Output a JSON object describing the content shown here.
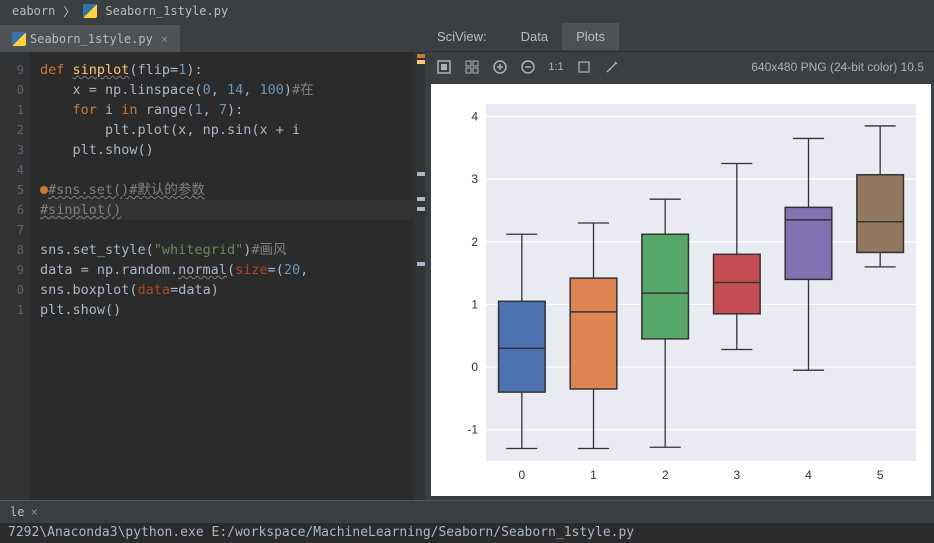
{
  "breadcrumb": {
    "folder": "eaborn",
    "file": "Seaborn_1style.py"
  },
  "editor": {
    "tab_name": "Seaborn_1style.py",
    "line_numbers": [
      "9",
      "0",
      "1",
      "2",
      "3",
      "4",
      "5",
      "6",
      "7",
      "8",
      "9",
      "0",
      "1"
    ],
    "code": {
      "l1_def": "def ",
      "l1_fn": "sinplot",
      "l1_rest": "(flip=",
      "l1_num": "1",
      "l1_end": "):",
      "l2_a": "    x = np.linspace(",
      "l2_n1": "0",
      "l2_c1": ", ",
      "l2_n2": "14",
      "l2_c2": ", ",
      "l2_n3": "100",
      "l2_end": ")",
      "l2_comment": "#在",
      "l3_a": "    ",
      "l3_for": "for ",
      "l3_b": "i ",
      "l3_in": "in ",
      "l3_c": "range(",
      "l3_n1": "1",
      "l3_c1": ", ",
      "l3_n2": "7",
      "l3_end": "):",
      "l4_a": "        plt.plot(x",
      "l4_c": ", ",
      "l4_b": "np.sin(x + i",
      "l5": "    plt.show()",
      "l7_comment": "#sns.set()#默认的参数",
      "l8_comment": "#sinplot()",
      "l10_a": "sns.set_style(",
      "l10_str": "\"whitegrid\"",
      "l10_b": ")",
      "l10_comment": "#画风",
      "l11_a": "data = np.random.",
      "l11_fn": "normal",
      "l11_b": "(",
      "l11_p": "size",
      "l11_c": "=(",
      "l11_n": "20",
      "l11_end": ",",
      "l12_a": "sns.boxplot(",
      "l12_p": "data",
      "l12_b": "=data)",
      "l13": "plt.show()"
    }
  },
  "sciview": {
    "title": "SciView:",
    "tab_data": "Data",
    "tab_plots": "Plots",
    "info": "640x480 PNG (24-bit color) 10.5",
    "toolbar": {
      "ratio": "1:1"
    }
  },
  "console": {
    "tab": "le",
    "text": "7292\\Anaconda3\\python.exe E:/workspace/MachineLearning/Seaborn/Seaborn_1style.py"
  },
  "chart_data": {
    "type": "box",
    "categories": [
      "0",
      "1",
      "2",
      "3",
      "4",
      "5"
    ],
    "ylim": [
      -1.5,
      4.2
    ],
    "yticks": [
      -1,
      0,
      1,
      2,
      3,
      4
    ],
    "series": [
      {
        "name": "0",
        "q1": -0.4,
        "median": 0.3,
        "q3": 1.05,
        "whisker_low": -1.3,
        "whisker_high": 2.12,
        "color": "#4c72b0"
      },
      {
        "name": "1",
        "q1": -0.35,
        "median": 0.88,
        "q3": 1.42,
        "whisker_low": -1.3,
        "whisker_high": 2.3,
        "color": "#dd8452"
      },
      {
        "name": "2",
        "q1": 0.45,
        "median": 1.18,
        "q3": 2.12,
        "whisker_low": -1.28,
        "whisker_high": 2.68,
        "color": "#55a868"
      },
      {
        "name": "3",
        "q1": 0.85,
        "median": 1.35,
        "q3": 1.8,
        "whisker_low": 0.28,
        "whisker_high": 3.25,
        "color": "#c44e52"
      },
      {
        "name": "4",
        "q1": 1.4,
        "median": 2.35,
        "q3": 2.55,
        "whisker_low": -0.05,
        "whisker_high": 3.65,
        "color": "#8172b3"
      },
      {
        "name": "5",
        "q1": 1.83,
        "median": 2.32,
        "q3": 3.07,
        "whisker_low": 1.6,
        "whisker_high": 3.85,
        "color": "#937860"
      }
    ]
  }
}
